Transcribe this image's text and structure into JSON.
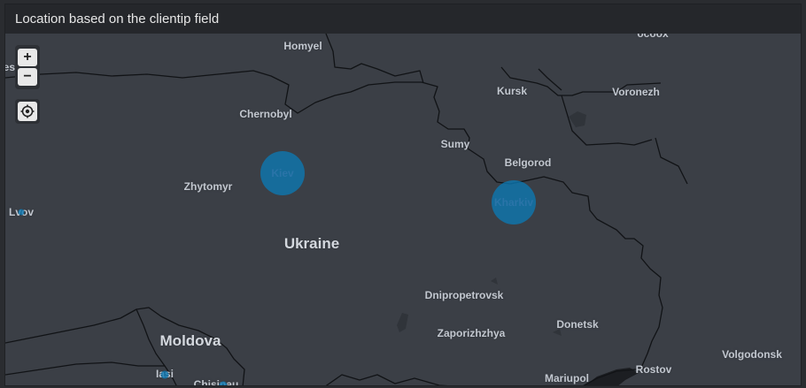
{
  "panel": {
    "title": "Location based on the clientip field"
  },
  "controls": {
    "zoom_in": "+",
    "zoom_out": "−"
  },
  "map": {
    "countries": {
      "ukraine": "Ukraine",
      "moldova": "Moldova"
    },
    "cities": {
      "homyel": "Homyel",
      "kursk": "Kursk",
      "voronezh": "Voronezh",
      "chernobyl": "Chernobyl",
      "sumy": "Sumy",
      "belgorod": "Belgorod",
      "zhytomyr": "Zhytomyr",
      "kiev": "Kiev",
      "kharkiv": "Kharkiv",
      "lvov": "Lvov",
      "dnipropetrovsk": "Dnipropetrovsk",
      "donetsk": "Donetsk",
      "zaporizhzhya": "Zaporizhzhya",
      "volgodonsk": "Volgodonsk",
      "rostov": "Rostov",
      "mariupol": "Mariupol",
      "iasi": "Iasi",
      "chisinau": "Chisinau",
      "brest_partial": "rest",
      "top_partial": "ocoox"
    },
    "marker_color": "#0c78b4",
    "border_color": "#111316",
    "water_color": "#2f3238"
  }
}
